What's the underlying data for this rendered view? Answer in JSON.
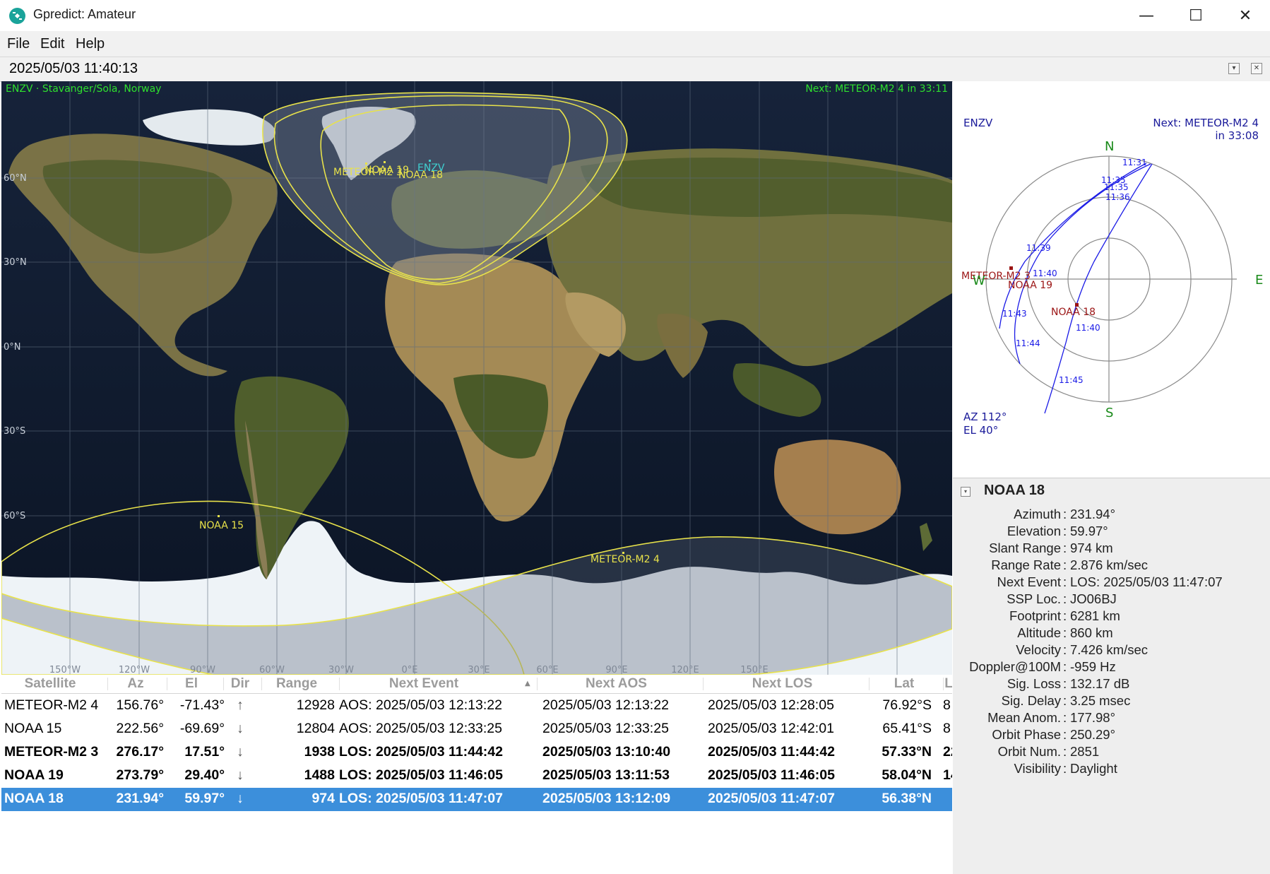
{
  "window": {
    "title": "Gpredict: Amateur",
    "minimize": "—",
    "maximize": "☐",
    "close": "✕",
    "icon": "satellite-icon"
  },
  "menu": {
    "file": "File",
    "edit": "Edit",
    "help": "Help"
  },
  "datetime": "2025/05/03 11:40:13",
  "map": {
    "station": "ENZV · Stavanger/Sola, Norway",
    "next": "Next: METEOR-M2 4 in 33:11",
    "lat_labels": [
      "60°N",
      "30°N",
      "0°N",
      "30°S",
      "60°S"
    ],
    "lon_labels": [
      "150°W",
      "120°W",
      "90°W",
      "60°W",
      "30°W",
      "0°E",
      "30°E",
      "60°E",
      "90°E",
      "120°E",
      "150°E"
    ],
    "sat_labels": {
      "noaa19": "NOAA 19",
      "meteor_m2_3": "METEOR-M2 3",
      "noaa18": "NOAA 18",
      "enzv": "ENZV",
      "noaa15": "NOAA 15",
      "meteor_m2_4": "METEOR-M2 4"
    },
    "colors": {
      "footprint": "#e8e24a",
      "grid": "#6b7a8c",
      "text": "#2ee02e",
      "station": "#3fd0d0"
    }
  },
  "polar": {
    "station": "ENZV",
    "next_line1": "Next: METEOR-M2 4",
    "next_line2": "in 33:08",
    "n": "N",
    "s": "S",
    "e": "E",
    "w": "W",
    "az": "AZ 112°",
    "el": "EL 40°",
    "times": [
      "11:31",
      "11:35",
      "11:35",
      "11:36",
      "11:39",
      "11:40",
      "11:43",
      "11:44",
      "11:40",
      "11:45"
    ],
    "sats": {
      "meteor": "METEOR-M2 3",
      "noaa19": "NOAA 19",
      "noaa18": "NOAA 18"
    }
  },
  "details": {
    "title": "NOAA 18",
    "rows": [
      {
        "label": "Azimuth",
        "value": "231.94°"
      },
      {
        "label": "Elevation",
        "value": " 59.97°"
      },
      {
        "label": "Slant Range",
        "value": "974 km"
      },
      {
        "label": "Range Rate",
        "value": "2.876 km/sec"
      },
      {
        "label": "Next Event",
        "value": "LOS: 2025/05/03 11:47:07"
      },
      {
        "label": "SSP Loc.",
        "value": "JO06BJ"
      },
      {
        "label": "Footprint",
        "value": "6281 km"
      },
      {
        "label": "Altitude",
        "value": "860 km"
      },
      {
        "label": "Velocity",
        "value": "7.426 km/sec"
      },
      {
        "label": "Doppler@100M",
        "value": "-959 Hz"
      },
      {
        "label": "Sig. Loss",
        "value": "132.17 dB"
      },
      {
        "label": "Sig. Delay",
        "value": "3.25 msec"
      },
      {
        "label": "Mean Anom.",
        "value": "177.98°"
      },
      {
        "label": "Orbit Phase",
        "value": "250.29°"
      },
      {
        "label": "Orbit Num.",
        "value": "2851"
      },
      {
        "label": "Visibility",
        "value": "Daylight"
      }
    ]
  },
  "table": {
    "headers": [
      "Satellite",
      "Az",
      "El",
      "Dir",
      "Range",
      "Next Event",
      "Next AOS",
      "Next LOS",
      "Lat",
      "L"
    ],
    "rows": [
      {
        "sat": "METEOR-M2 4",
        "az": "156.76°",
        "el": "-71.43°",
        "dir": "↑",
        "range": "12928",
        "event": "AOS: 2025/05/03 12:13:22",
        "aos": "2025/05/03 12:13:22",
        "los": "2025/05/03 12:28:05",
        "lat": "76.92°S",
        "lon": "8"
      },
      {
        "sat": "NOAA 15",
        "az": "222.56°",
        "el": "-69.69°",
        "dir": "↓",
        "range": "12804",
        "event": "AOS: 2025/05/03 12:33:25",
        "aos": "2025/05/03 12:33:25",
        "los": "2025/05/03 12:42:01",
        "lat": "65.41°S",
        "lon": "8"
      },
      {
        "sat": "METEOR-M2 3",
        "az": "276.17°",
        "el": "17.51°",
        "dir": "↓",
        "range": "1938",
        "event": "LOS: 2025/05/03 11:44:42",
        "aos": "2025/05/03 13:10:40",
        "los": "2025/05/03 11:44:42",
        "lat": "57.33°N",
        "lon": "22"
      },
      {
        "sat": "NOAA 19",
        "az": "273.79°",
        "el": "29.40°",
        "dir": "↓",
        "range": "1488",
        "event": "LOS: 2025/05/03 11:46:05",
        "aos": "2025/05/03 13:11:53",
        "los": "2025/05/03 11:46:05",
        "lat": "58.04°N",
        "lon": "14"
      },
      {
        "sat": "NOAA 18",
        "az": "231.94°",
        "el": "59.97°",
        "dir": "↓",
        "range": "974",
        "event": "LOS: 2025/05/03 11:47:07",
        "aos": "2025/05/03 13:12:09",
        "los": "2025/05/03 11:47:07",
        "lat": "56.38°N",
        "lon": ""
      }
    ]
  }
}
